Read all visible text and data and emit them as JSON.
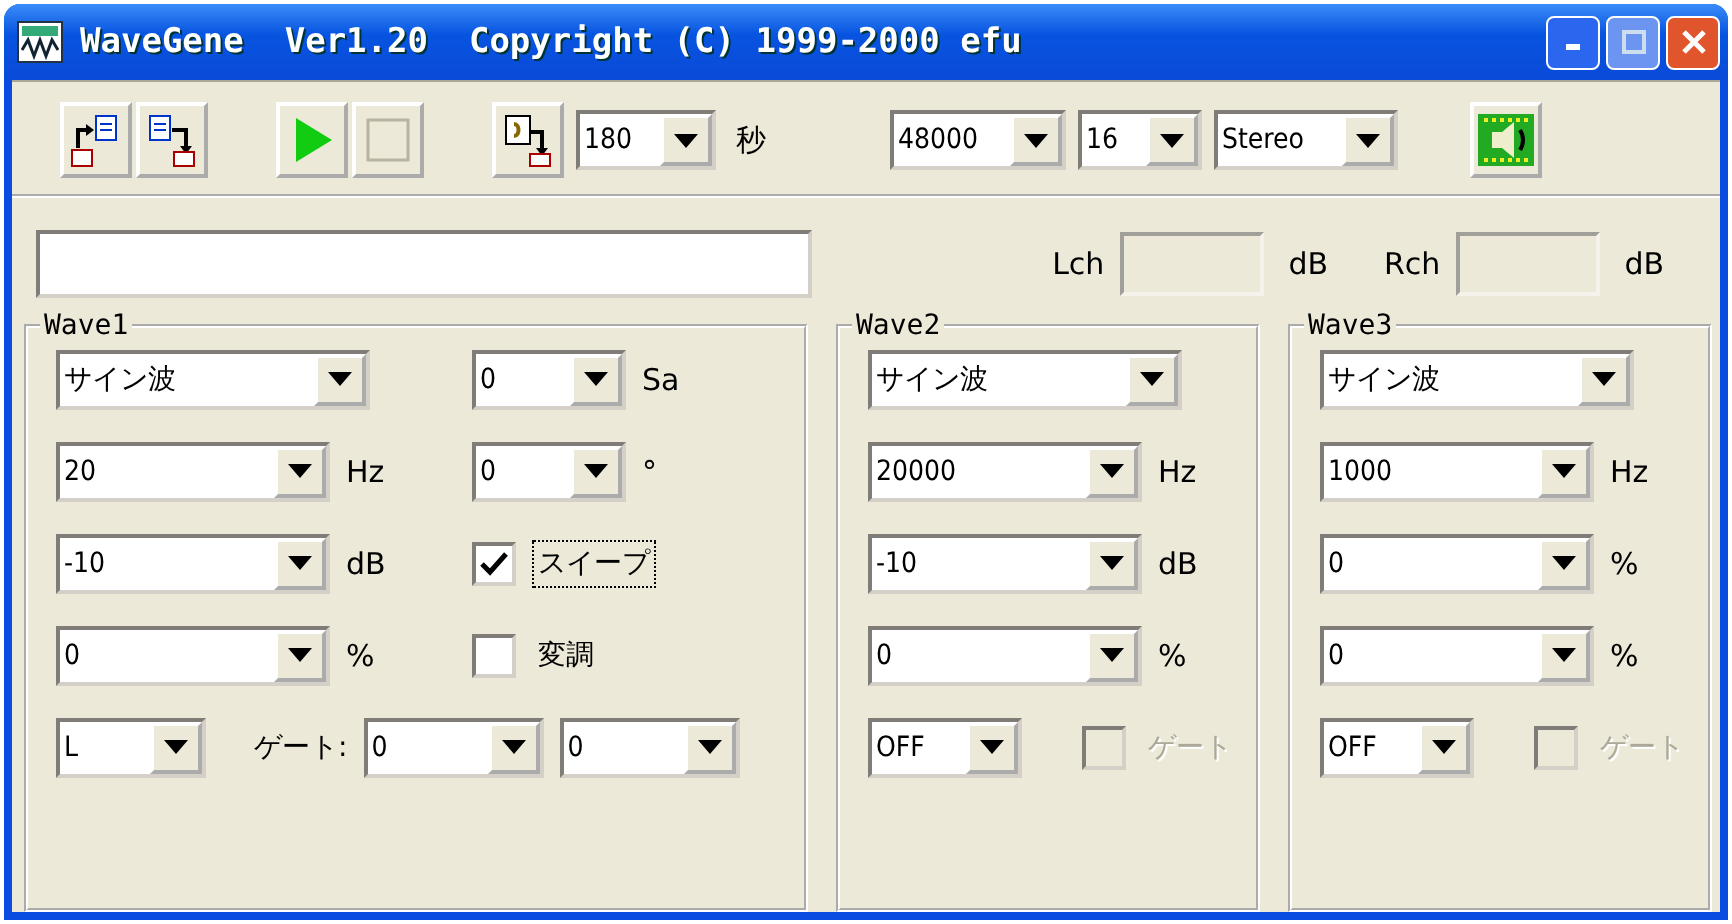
{
  "window": {
    "title": "WaveGene  Ver1.20  Copyright (C) 1999-2000 efu"
  },
  "toolbar": {
    "duration": "180",
    "duration_unit": "秒",
    "sample_rate": "48000",
    "bits": "16",
    "channels": "Stereo"
  },
  "levels": [
    {
      "label": "Lch",
      "unit": "dB"
    },
    {
      "label": "Rch",
      "unit": "dB"
    }
  ],
  "waves": [
    {
      "title": "Wave1",
      "type": "サイン波",
      "fields": [
        {
          "value": "20",
          "unit": "Hz"
        },
        {
          "value": "-10",
          "unit": "dB"
        },
        {
          "value": "0",
          "unit": "%"
        }
      ],
      "extras": [
        {
          "kind": "combo",
          "value": "0",
          "unit": "Sa"
        },
        {
          "kind": "combo",
          "value": "0",
          "unit": "°"
        },
        {
          "kind": "checkbox",
          "label": "スイープ",
          "checked": true,
          "focused": true
        },
        {
          "kind": "checkbox",
          "label": "変調",
          "checked": false,
          "focused": false
        }
      ],
      "channel": "L",
      "gate": {
        "kind": "combos",
        "label": "ゲート:",
        "values": [
          "0",
          "0"
        ]
      }
    },
    {
      "title": "Wave2",
      "type": "サイン波",
      "fields": [
        {
          "value": "20000",
          "unit": "Hz"
        },
        {
          "value": "-10",
          "unit": "dB"
        },
        {
          "value": "0",
          "unit": "%"
        }
      ],
      "channel": "OFF",
      "gate": {
        "kind": "checkbox",
        "label": "ゲート",
        "checked": false,
        "disabled": true
      }
    },
    {
      "title": "Wave3",
      "type": "サイン波",
      "fields": [
        {
          "value": "1000",
          "unit": "Hz"
        },
        {
          "value": "0",
          "unit": "%"
        },
        {
          "value": "0",
          "unit": "%"
        }
      ],
      "channel": "OFF",
      "gate": {
        "kind": "checkbox",
        "label": "ゲート",
        "checked": false,
        "disabled": true
      }
    }
  ]
}
